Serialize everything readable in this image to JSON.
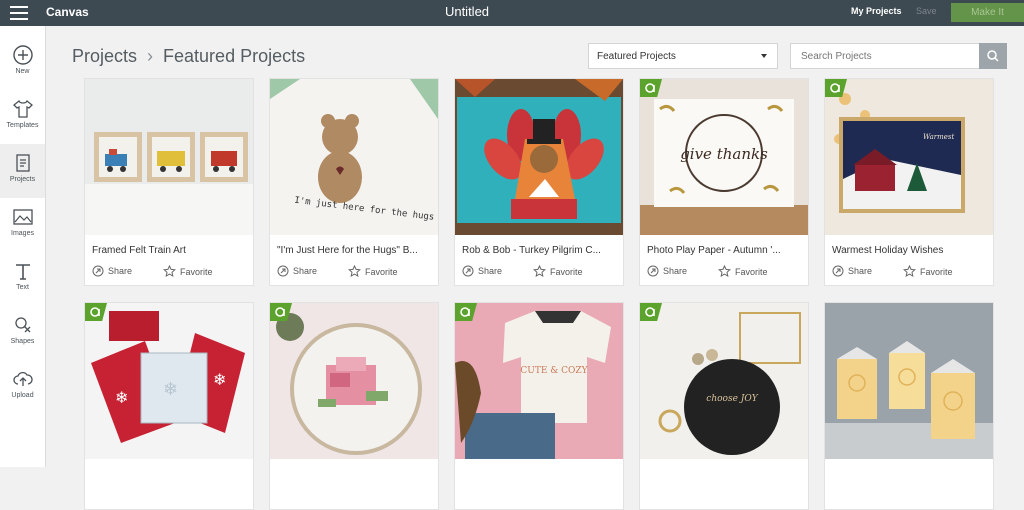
{
  "topbar": {
    "app_name": "Canvas",
    "doc_title": "Untitled",
    "my_projects": "My Projects",
    "save": "Save",
    "make_it": "Make It"
  },
  "sidebar": {
    "items": [
      {
        "label": "New",
        "icon": "plus-icon"
      },
      {
        "label": "Templates",
        "icon": "shirt-icon"
      },
      {
        "label": "Projects",
        "icon": "projects-icon"
      },
      {
        "label": "Images",
        "icon": "image-icon"
      },
      {
        "label": "Text",
        "icon": "text-icon"
      },
      {
        "label": "Shapes",
        "icon": "shapes-icon"
      },
      {
        "label": "Upload",
        "icon": "upload-icon"
      }
    ]
  },
  "breadcrumb": {
    "root": "Projects",
    "current": "Featured Projects"
  },
  "filter": {
    "selected": "Featured Projects"
  },
  "search": {
    "placeholder": "Search Projects"
  },
  "card_actions": {
    "share": "Share",
    "favorite": "Favorite"
  },
  "cards": [
    {
      "title": "Framed Felt Train Art",
      "badge": false
    },
    {
      "title": "\"I'm Just Here for the Hugs\" B...",
      "badge": false,
      "img_text": "I'm just here for the hugs"
    },
    {
      "title": "Rob & Bob - Turkey Pilgrim C...",
      "badge": false
    },
    {
      "title": "Photo Play Paper - Autumn '...",
      "badge": true,
      "img_text": "give thanks"
    },
    {
      "title": "Warmest Holiday Wishes",
      "badge": true
    },
    {
      "badge": true
    },
    {
      "badge": true
    },
    {
      "badge": true,
      "img_text": "CUTE & COZY"
    },
    {
      "badge": true,
      "img_text": "choose JOY"
    },
    {
      "badge": false
    }
  ],
  "colors": {
    "topbar": "#3e4a52",
    "make_it": "#64944a",
    "badge": "#5ba32c"
  }
}
